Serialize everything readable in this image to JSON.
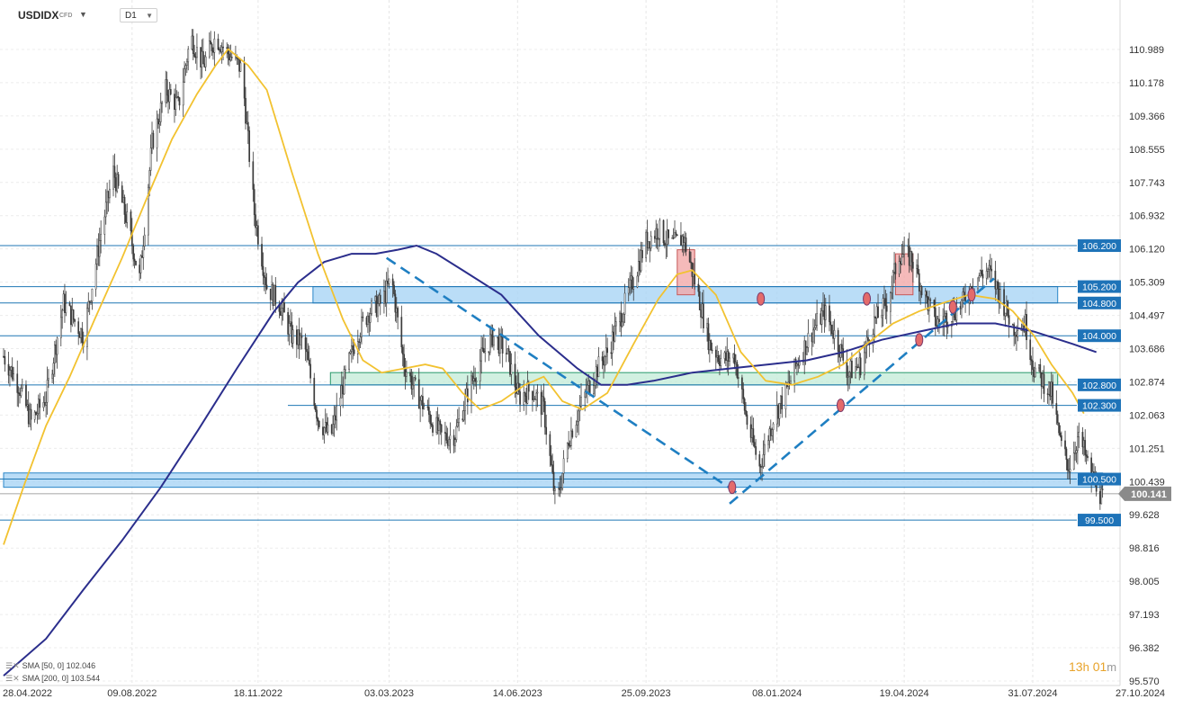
{
  "header": {
    "symbol": "USDIDX",
    "type": "CFD",
    "timeframe": "D1"
  },
  "legend": [
    {
      "label": "SMA [50, 0] 102.046",
      "color": "#f2c230"
    },
    {
      "label": "SMA [200, 0] 103.544",
      "color": "#2b2e8c"
    }
  ],
  "countdown": {
    "h": "13",
    "h_unit": "h",
    "m": "01",
    "m_unit": "m"
  },
  "colors": {
    "candle": "#3a3a3a",
    "sma50": "#f2c230",
    "sma200": "#2b2e8c",
    "level_line": "#1f77b4",
    "level_badge": "#1e73b8",
    "blue_zone": "#a9d4f5",
    "green_zone": "#c6ecd9",
    "red_zone": "#f2a9a9",
    "trend_dash": "#1f7fc2",
    "price_badge": "#8a8a8a"
  },
  "chart_data": {
    "type": "candlestick",
    "y_axis": {
      "ylim": [
        95.57,
        111.4
      ],
      "tick_labels": [
        "110.989",
        "110.178",
        "109.366",
        "108.555",
        "107.743",
        "106.932",
        "106.120",
        "105.309",
        "104.497",
        "103.686",
        "102.874",
        "102.063",
        "101.251",
        "100.439",
        "99.628",
        "98.816",
        "98.005",
        "97.193",
        "96.382",
        "95.570"
      ]
    },
    "x_axis": {
      "tick_labels": [
        "28.04.2022",
        "09.08.2022",
        "18.11.2022",
        "03.03.2023",
        "14.06.2023",
        "25.09.2023",
        "08.01.2024",
        "19.04.2024",
        "31.07.2024",
        "27.10.2024"
      ]
    },
    "levels": [
      {
        "label": "106.200",
        "value": 106.2
      },
      {
        "label": "105.200",
        "value": 105.2
      },
      {
        "label": "104.800",
        "value": 104.8
      },
      {
        "label": "104.000",
        "value": 104.0
      },
      {
        "label": "102.800",
        "value": 102.8
      },
      {
        "label": "102.300",
        "value": 102.3
      },
      {
        "label": "100.500",
        "value": 100.5
      },
      {
        "label": "99.500",
        "value": 99.5
      }
    ],
    "current_price": {
      "label": "100.141",
      "value": 100.141
    },
    "zones": [
      {
        "kind": "blue",
        "from_date": "01.01.2023",
        "to_date": "20.08.2024",
        "low": 104.8,
        "high": 105.2
      },
      {
        "kind": "green",
        "from_date": "15.01.2023",
        "to_date": "20.08.2024",
        "low": 102.8,
        "high": 103.1
      },
      {
        "kind": "blue",
        "from_date": "28.04.2022",
        "to_date": "25.09.2024",
        "low": 100.3,
        "high": 100.65
      },
      {
        "kind": "red",
        "from_date": "20.10.2023",
        "to_date": "03.11.2023",
        "low": 105.0,
        "high": 106.1
      },
      {
        "kind": "red",
        "from_date": "12.04.2024",
        "to_date": "26.04.2024",
        "low": 105.0,
        "high": 106.0
      }
    ],
    "trendlines": [
      {
        "from": [
          "01.03.2023",
          105.9
        ],
        "to": [
          "10.12.2023",
          100.1
        ]
      },
      {
        "from": [
          "01.12.2023",
          99.9
        ],
        "to": [
          "30.06.2024",
          105.4
        ]
      }
    ],
    "markers": [
      {
        "date": "03.12.2023",
        "value": 100.3
      },
      {
        "date": "26.12.2023",
        "value": 104.9
      },
      {
        "date": "28.02.2024",
        "value": 102.3
      },
      {
        "date": "20.03.2024",
        "value": 104.9
      },
      {
        "date": "01.05.2024",
        "value": 103.9
      },
      {
        "date": "28.05.2024",
        "value": 104.7
      },
      {
        "date": "12.06.2024",
        "value": 105.0
      }
    ],
    "sma50": [
      [
        "28.04.2022",
        98.9
      ],
      [
        "15.05.2022",
        100.4
      ],
      [
        "01.06.2022",
        101.8
      ],
      [
        "20.06.2022",
        103.0
      ],
      [
        "10.07.2022",
        104.4
      ],
      [
        "01.08.2022",
        105.9
      ],
      [
        "20.08.2022",
        107.3
      ],
      [
        "10.09.2022",
        108.8
      ],
      [
        "30.09.2022",
        109.9
      ],
      [
        "15.10.2022",
        110.6
      ],
      [
        "25.10.2022",
        111.0
      ],
      [
        "10.11.2022",
        110.6
      ],
      [
        "25.11.2022",
        110.0
      ],
      [
        "15.12.2022",
        108.0
      ],
      [
        "05.01.2023",
        106.0
      ],
      [
        "25.01.2023",
        104.4
      ],
      [
        "10.02.2023",
        103.4
      ],
      [
        "25.02.2023",
        103.1
      ],
      [
        "15.03.2023",
        103.2
      ],
      [
        "01.04.2023",
        103.3
      ],
      [
        "15.04.2023",
        103.2
      ],
      [
        "01.05.2023",
        102.6
      ],
      [
        "15.05.2023",
        102.2
      ],
      [
        "01.06.2023",
        102.4
      ],
      [
        "20.06.2023",
        102.8
      ],
      [
        "05.07.2023",
        103.0
      ],
      [
        "20.07.2023",
        102.4
      ],
      [
        "05.08.2023",
        102.2
      ],
      [
        "25.08.2023",
        102.6
      ],
      [
        "15.09.2023",
        103.8
      ],
      [
        "05.10.2023",
        104.9
      ],
      [
        "20.10.2023",
        105.5
      ],
      [
        "01.11.2023",
        105.6
      ],
      [
        "20.11.2023",
        105.0
      ],
      [
        "10.12.2023",
        103.6
      ],
      [
        "30.12.2023",
        102.9
      ],
      [
        "20.01.2024",
        102.8
      ],
      [
        "10.02.2024",
        103.0
      ],
      [
        "01.03.2024",
        103.3
      ],
      [
        "20.03.2024",
        103.8
      ],
      [
        "10.04.2024",
        104.3
      ],
      [
        "01.05.2024",
        104.6
      ],
      [
        "20.05.2024",
        104.8
      ],
      [
        "10.06.2024",
        105.0
      ],
      [
        "01.07.2024",
        104.9
      ],
      [
        "15.07.2024",
        104.6
      ],
      [
        "01.08.2024",
        104.0
      ],
      [
        "15.08.2024",
        103.3
      ],
      [
        "01.09.2024",
        102.6
      ],
      [
        "10.09.2024",
        102.1
      ]
    ],
    "sma200": [
      [
        "28.04.2022",
        95.7
      ],
      [
        "01.06.2022",
        96.6
      ],
      [
        "01.07.2022",
        97.8
      ],
      [
        "01.08.2022",
        99.0
      ],
      [
        "01.09.2022",
        100.3
      ],
      [
        "01.10.2022",
        101.7
      ],
      [
        "01.11.2022",
        103.2
      ],
      [
        "01.12.2022",
        104.6
      ],
      [
        "20.12.2022",
        105.3
      ],
      [
        "10.01.2023",
        105.8
      ],
      [
        "01.02.2023",
        106.0
      ],
      [
        "20.02.2023",
        106.0
      ],
      [
        "10.03.2023",
        106.1
      ],
      [
        "25.03.2023",
        106.2
      ],
      [
        "10.04.2023",
        106.0
      ],
      [
        "01.05.2023",
        105.6
      ],
      [
        "01.06.2023",
        105.0
      ],
      [
        "01.07.2023",
        104.0
      ],
      [
        "01.08.2023",
        103.2
      ],
      [
        "20.08.2023",
        102.8
      ],
      [
        "10.09.2023",
        102.8
      ],
      [
        "01.10.2023",
        102.9
      ],
      [
        "01.11.2023",
        103.1
      ],
      [
        "01.12.2023",
        103.2
      ],
      [
        "01.01.2024",
        103.3
      ],
      [
        "01.02.2024",
        103.4
      ],
      [
        "01.03.2024",
        103.6
      ],
      [
        "01.04.2024",
        103.9
      ],
      [
        "01.05.2024",
        104.1
      ],
      [
        "01.06.2024",
        104.3
      ],
      [
        "01.07.2024",
        104.3
      ],
      [
        "01.08.2024",
        104.1
      ],
      [
        "01.09.2024",
        103.8
      ],
      [
        "20.09.2024",
        103.6
      ]
    ],
    "price_path": [
      [
        "28.04.2022",
        103.5
      ],
      [
        "10.05.2022",
        102.8
      ],
      [
        "20.05.2022",
        101.9
      ],
      [
        "01.06.2022",
        102.5
      ],
      [
        "15.06.2022",
        104.8
      ],
      [
        "01.07.2022",
        104.0
      ],
      [
        "15.07.2022",
        106.5
      ],
      [
        "25.07.2022",
        108.0
      ],
      [
        "05.08.2022",
        106.8
      ],
      [
        "15.08.2022",
        105.4
      ],
      [
        "25.08.2022",
        108.7
      ],
      [
        "05.09.2022",
        110.0
      ],
      [
        "15.09.2022",
        109.6
      ],
      [
        "25.09.2022",
        111.3
      ],
      [
        "05.10.2022",
        110.6
      ],
      [
        "15.10.2022",
        111.3
      ],
      [
        "25.10.2022",
        110.9
      ],
      [
        "05.11.2022",
        110.5
      ],
      [
        "15.11.2022",
        107.0
      ],
      [
        "25.11.2022",
        105.2
      ],
      [
        "05.12.2022",
        104.8
      ],
      [
        "15.12.2022",
        104.0
      ],
      [
        "25.12.2022",
        103.8
      ],
      [
        "05.01.2023",
        102.0
      ],
      [
        "15.01.2023",
        101.5
      ],
      [
        "25.01.2023",
        102.8
      ],
      [
        "05.02.2023",
        104.0
      ],
      [
        "15.02.2023",
        104.6
      ],
      [
        "25.02.2023",
        104.8
      ],
      [
        "05.03.2023",
        105.4
      ],
      [
        "15.03.2023",
        103.3
      ],
      [
        "25.03.2023",
        102.6
      ],
      [
        "05.04.2023",
        102.0
      ],
      [
        "15.04.2023",
        101.5
      ],
      [
        "25.04.2023",
        101.6
      ],
      [
        "05.05.2023",
        102.6
      ],
      [
        "15.05.2023",
        103.4
      ],
      [
        "25.05.2023",
        104.0
      ],
      [
        "05.06.2023",
        103.6
      ],
      [
        "15.06.2023",
        102.5
      ],
      [
        "25.06.2023",
        102.7
      ],
      [
        "05.07.2023",
        102.2
      ],
      [
        "15.07.2023",
        99.8
      ],
      [
        "25.07.2023",
        101.5
      ],
      [
        "05.08.2023",
        102.4
      ],
      [
        "15.08.2023",
        103.1
      ],
      [
        "25.08.2023",
        103.6
      ],
      [
        "05.09.2023",
        104.5
      ],
      [
        "15.09.2023",
        105.4
      ],
      [
        "25.09.2023",
        106.3
      ],
      [
        "05.10.2023",
        106.6
      ],
      [
        "15.10.2023",
        106.2
      ],
      [
        "25.10.2023",
        106.4
      ],
      [
        "05.11.2023",
        105.1
      ],
      [
        "15.11.2023",
        103.8
      ],
      [
        "25.11.2023",
        103.4
      ],
      [
        "05.12.2023",
        103.5
      ],
      [
        "15.12.2023",
        101.9
      ],
      [
        "25.12.2023",
        100.8
      ],
      [
        "05.01.2024",
        102.0
      ],
      [
        "15.01.2024",
        102.6
      ],
      [
        "25.01.2024",
        103.4
      ],
      [
        "05.02.2024",
        104.1
      ],
      [
        "15.02.2024",
        104.6
      ],
      [
        "25.02.2024",
        103.9
      ],
      [
        "05.03.2024",
        103.1
      ],
      [
        "15.03.2024",
        103.3
      ],
      [
        "25.03.2024",
        104.3
      ],
      [
        "05.04.2024",
        104.8
      ],
      [
        "15.04.2024",
        106.0
      ],
      [
        "25.04.2024",
        105.9
      ],
      [
        "05.05.2024",
        105.0
      ],
      [
        "15.05.2024",
        104.3
      ],
      [
        "25.05.2024",
        104.5
      ],
      [
        "05.06.2024",
        104.8
      ],
      [
        "15.06.2024",
        105.4
      ],
      [
        "25.06.2024",
        105.6
      ],
      [
        "05.07.2024",
        105.0
      ],
      [
        "15.07.2024",
        104.2
      ],
      [
        "25.07.2024",
        104.3
      ],
      [
        "01.08.2024",
        103.2
      ],
      [
        "08.08.2024",
        102.9
      ],
      [
        "15.08.2024",
        102.6
      ],
      [
        "22.08.2024",
        101.4
      ],
      [
        "29.08.2024",
        100.8
      ],
      [
        "05.09.2024",
        101.5
      ],
      [
        "10.09.2024",
        101.2
      ],
      [
        "15.09.2024",
        100.6
      ],
      [
        "20.09.2024",
        100.4
      ],
      [
        "25.09.2024",
        100.0
      ]
    ]
  }
}
